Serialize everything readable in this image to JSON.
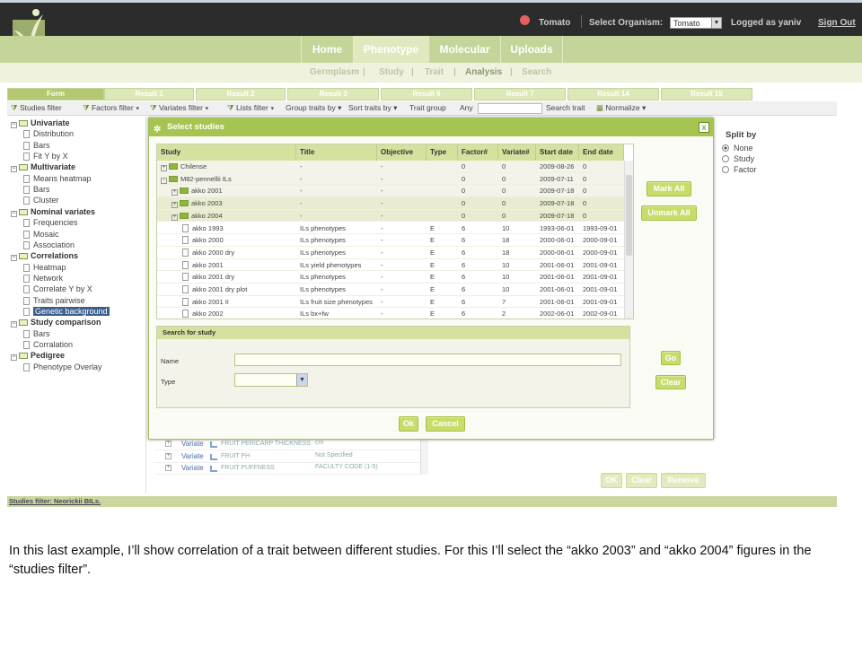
{
  "header": {
    "organism_name": "Tomato",
    "select_organism_label": "Select Organism:",
    "select_organism_value": "Tomato",
    "logged_as": "Logged as yaniv",
    "sign_out": "Sign Out"
  },
  "nav_tabs": [
    "Home",
    "Phenotype",
    "Molecular",
    "Uploads"
  ],
  "sub_nav": [
    "Germplasm",
    "|",
    "Study",
    "|",
    "Trait",
    "|",
    "Analysis",
    "|",
    "Search"
  ],
  "result_tabs": [
    "Form",
    "Result 1",
    "Result 2",
    "Result 3",
    "Result 6",
    "Result 7",
    "Result 14",
    "Result 15"
  ],
  "toolbar": {
    "studies_filter": "Studies filter",
    "factors_filter": "Factors filter",
    "variates_filter": "Variates filter",
    "lists_filter": "Lists filter",
    "group_traits_by": "Group traits by",
    "sort_traits_by": "Sort traits by",
    "trait_group": "Trait group",
    "any": "Any",
    "search_trait": "Search trait",
    "normalize": "Normalize"
  },
  "tree": [
    {
      "label": "Univariate",
      "cat": true
    },
    {
      "label": "Distribution",
      "cat": false
    },
    {
      "label": "Bars",
      "cat": false
    },
    {
      "label": "Fit Y by X",
      "cat": false
    },
    {
      "label": "Multivariate",
      "cat": true
    },
    {
      "label": "Means heatmap",
      "cat": false
    },
    {
      "label": "Bars",
      "cat": false
    },
    {
      "label": "Cluster",
      "cat": false
    },
    {
      "label": "Nominal variates",
      "cat": true
    },
    {
      "label": "Frequencies",
      "cat": false
    },
    {
      "label": "Mosaic",
      "cat": false
    },
    {
      "label": "Association",
      "cat": false
    },
    {
      "label": "Correlations",
      "cat": true
    },
    {
      "label": "Heatmap",
      "cat": false
    },
    {
      "label": "Network",
      "cat": false
    },
    {
      "label": "Correlate Y by X",
      "cat": false
    },
    {
      "label": "Traits pairwise",
      "cat": false
    },
    {
      "label": "Genetic background",
      "cat": false,
      "selected": true
    },
    {
      "label": "Study comparison",
      "cat": true
    },
    {
      "label": "Bars",
      "cat": false
    },
    {
      "label": "Corralation",
      "cat": false
    },
    {
      "label": "Pedigree",
      "cat": true
    },
    {
      "label": "Phenotype Overlay",
      "cat": false
    }
  ],
  "status_bar": "Studies filter: Neorickii BILs.",
  "split_by": {
    "title": "Split by",
    "options": [
      "None",
      "Study",
      "Factor"
    ],
    "selected": "None"
  },
  "modal": {
    "title": "Select studies",
    "close": "x",
    "columns": [
      "Study",
      "Title",
      "Objective",
      "Type",
      "Factor#",
      "Variate#",
      "Start date",
      "End date"
    ],
    "rows": [
      {
        "indent": 0,
        "kind": "folder",
        "expand": "+",
        "study": "Chilense",
        "title": "-",
        "objective": "-",
        "type": "",
        "factor": "0",
        "variate": "0",
        "start": "2009-08-26",
        "end": "0",
        "highlight": false
      },
      {
        "indent": 0,
        "kind": "folder",
        "expand": "-",
        "study": "M82-pennellii ILs",
        "title": "-",
        "objective": "-",
        "type": "",
        "factor": "0",
        "variate": "0",
        "start": "2009-07-11",
        "end": "0",
        "highlight": false
      },
      {
        "indent": 1,
        "kind": "folder",
        "expand": "+",
        "study": "akko 2001",
        "title": "-",
        "objective": "-",
        "type": "",
        "factor": "0",
        "variate": "0",
        "start": "2009-07-18",
        "end": "0",
        "highlight": false
      },
      {
        "indent": 1,
        "kind": "folder",
        "expand": "+",
        "study": "akko 2003",
        "title": "-",
        "objective": "-",
        "type": "",
        "factor": "0",
        "variate": "0",
        "start": "2009-07-18",
        "end": "0",
        "highlight": true
      },
      {
        "indent": 1,
        "kind": "folder",
        "expand": "+",
        "study": "akko 2004",
        "title": "-",
        "objective": "-",
        "type": "",
        "factor": "0",
        "variate": "0",
        "start": "2009-07-18",
        "end": "0",
        "highlight": true
      },
      {
        "indent": 2,
        "kind": "leaf",
        "expand": "",
        "study": "akko 1993",
        "title": "ILs phenotypes",
        "objective": "-",
        "type": "E",
        "factor": "6",
        "variate": "10",
        "start": "1993-06-01",
        "end": "1993-09-01",
        "highlight": false
      },
      {
        "indent": 2,
        "kind": "leaf",
        "expand": "",
        "study": "akko 2000",
        "title": "ILs phenotypes",
        "objective": "-",
        "type": "E",
        "factor": "6",
        "variate": "18",
        "start": "2000-06-01",
        "end": "2000-09-01",
        "highlight": false
      },
      {
        "indent": 2,
        "kind": "leaf",
        "expand": "",
        "study": "akko 2000 dry",
        "title": "ILs phenotypes",
        "objective": "-",
        "type": "E",
        "factor": "6",
        "variate": "18",
        "start": "2000-06-01",
        "end": "2000-09-01",
        "highlight": false
      },
      {
        "indent": 2,
        "kind": "leaf",
        "expand": "",
        "study": "akko 2001",
        "title": "ILs yield phenotypes",
        "objective": "-",
        "type": "E",
        "factor": "6",
        "variate": "10",
        "start": "2001-06-01",
        "end": "2001-09-01",
        "highlight": false
      },
      {
        "indent": 2,
        "kind": "leaf",
        "expand": "",
        "study": "akko 2001 dry",
        "title": "ILs phenotypes",
        "objective": "-",
        "type": "E",
        "factor": "6",
        "variate": "10",
        "start": "2001-06-01",
        "end": "2001-09-01",
        "highlight": false
      },
      {
        "indent": 2,
        "kind": "leaf",
        "expand": "",
        "study": "akko 2001 dry plot",
        "title": "ILs phenotypes",
        "objective": "-",
        "type": "E",
        "factor": "6",
        "variate": "10",
        "start": "2001-06-01",
        "end": "2001-09-01",
        "highlight": false
      },
      {
        "indent": 2,
        "kind": "leaf",
        "expand": "",
        "study": "akko 2001 II",
        "title": "ILs fruit size phenotypes",
        "objective": "-",
        "type": "E",
        "factor": "6",
        "variate": "7",
        "start": "2001-06-01",
        "end": "2001-09-01",
        "highlight": false
      },
      {
        "indent": 2,
        "kind": "leaf",
        "expand": "",
        "study": "akko 2002",
        "title": "ILs bx+fw",
        "objective": "-",
        "type": "E",
        "factor": "6",
        "variate": "2",
        "start": "2002-06-01",
        "end": "2002-09-01",
        "highlight": false
      }
    ],
    "mark_all": "Mark All",
    "unmark_all": "Unmark All",
    "search_title": "Search for study",
    "name_label": "Name",
    "name_value": "",
    "type_label": "Type",
    "type_value": "",
    "go": "Go",
    "clear": "Clear",
    "ok": "Ok",
    "cancel": "Cancel"
  },
  "bg_rows": [
    {
      "kind": "Variate",
      "trait": "FRUIT PERICARP THICKNESS",
      "unit": "cm"
    },
    {
      "kind": "Variate",
      "trait": "FRUIT PH",
      "unit": "Not Specified"
    },
    {
      "kind": "Variate",
      "trait": "FRUIT PUFFNESS",
      "unit": "FACULTY CODE (1-5)"
    }
  ],
  "bg_buttons": {
    "ok": "OK",
    "clear": "Clear",
    "remove": "Remove"
  },
  "caption": "In this last example, I’ll show correlation of a trait between different studies. For this I’ll select the “akko 2003” and “akko 2004” figures in the “studies filter”.",
  "colors": {
    "accent": "#a6c451",
    "nav_bg": "#c5d59a",
    "header_bg": "#2c2c2c",
    "highlight_row": "#e9ecd0"
  }
}
